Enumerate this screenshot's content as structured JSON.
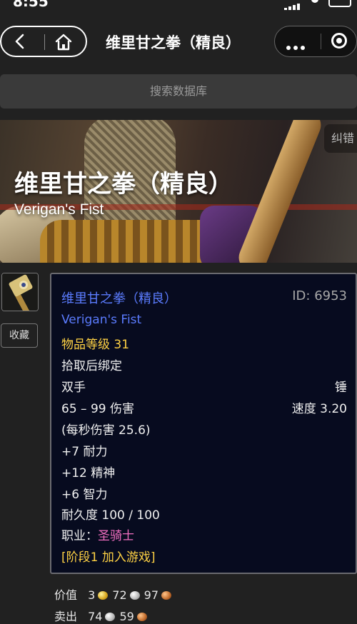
{
  "status_bar": {
    "time": "8:55"
  },
  "nav": {
    "title": "维里甘之拳（精良）"
  },
  "search": {
    "placeholder": "搜索数据库"
  },
  "hero": {
    "title_cn": "维里甘之拳（精良）",
    "title_en": "Verigan's Fist",
    "report_label": "纠错"
  },
  "sidebar": {
    "collect_label": "收藏"
  },
  "tooltip": {
    "name_cn": "维里甘之拳（精良）",
    "id": "ID: 6953",
    "name_en": "Verigan's Fist",
    "item_level": "物品等级 31",
    "bind": "拾取后绑定",
    "slot": "双手",
    "type": "锤",
    "damage": "65 – 99 伤害",
    "speed": "速度 3.20",
    "dps": "(每秒伤害 25.6)",
    "stat1": "+7 耐力",
    "stat2": "+12 精神",
    "stat3": "+6 智力",
    "durability": "耐久度 100 / 100",
    "class_label": "职业：",
    "class_value": "圣骑士",
    "phase": "[阶段1 加入游戏]"
  },
  "price": {
    "value_label": "价值",
    "value_gold": "3",
    "value_silver": "72",
    "value_copper": "97",
    "sell_label": "卖出",
    "sell_silver": "74",
    "sell_copper": "59"
  },
  "colors": {
    "item_blue": "#5b7cff",
    "item_level_gold": "#ffd244",
    "class_pink": "#f36fc1",
    "tooltip_bg": "#070b1f"
  }
}
